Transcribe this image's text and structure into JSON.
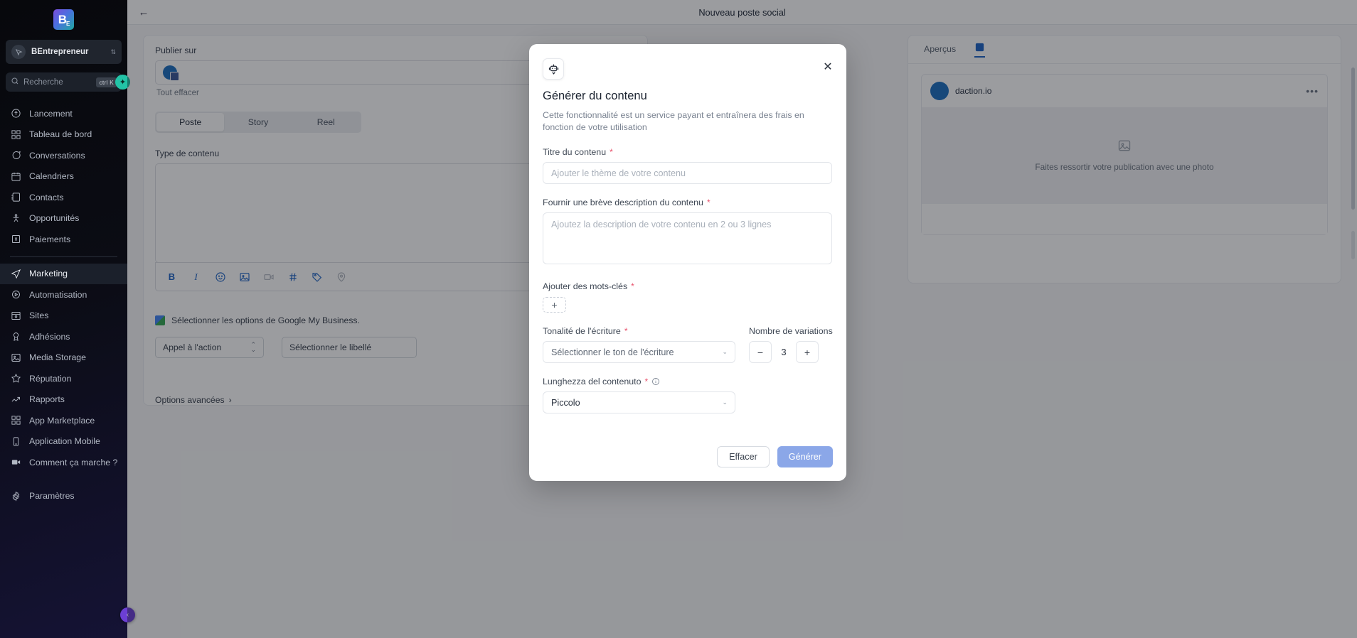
{
  "sidebar": {
    "logo_text": "B",
    "logo_sub": "E",
    "account": {
      "name": "BEntrepreneur",
      "chevron": "⌃⌄"
    },
    "search": {
      "placeholder": "Recherche",
      "shortcut": "ctrl K",
      "spark_icon": "sparkle-icon"
    },
    "items": [
      {
        "label": "Lancement",
        "icon": "rocket-launch-icon",
        "active": false
      },
      {
        "label": "Tableau de bord",
        "icon": "dashboard-grid-icon",
        "active": false
      },
      {
        "label": "Conversations",
        "icon": "chat-bubble-icon",
        "active": false
      },
      {
        "label": "Calendriers",
        "icon": "calendar-icon",
        "active": false
      },
      {
        "label": "Contacts",
        "icon": "contacts-book-icon",
        "active": false
      },
      {
        "label": "Opportunités",
        "icon": "opportunities-icon",
        "active": false
      },
      {
        "label": "Paiements",
        "icon": "payments-icon",
        "active": false
      },
      {
        "label": "Marketing",
        "icon": "send-paper-plane-icon",
        "active": true
      },
      {
        "label": "Automatisation",
        "icon": "play-circle-icon",
        "active": false
      },
      {
        "label": "Sites",
        "icon": "browser-window-icon",
        "active": false
      },
      {
        "label": "Adhésions",
        "icon": "award-badge-icon",
        "active": false
      },
      {
        "label": "Media Storage",
        "icon": "image-icon",
        "active": false
      },
      {
        "label": "Réputation",
        "icon": "star-icon",
        "active": false
      },
      {
        "label": "Rapports",
        "icon": "trend-up-icon",
        "active": false
      },
      {
        "label": "App Marketplace",
        "icon": "apps-grid-icon",
        "active": false
      },
      {
        "label": "Application Mobile",
        "icon": "mobile-phone-icon",
        "active": false
      },
      {
        "label": "Comment ça marche ?",
        "icon": "video-camera-icon",
        "active": false
      }
    ],
    "settings": {
      "label": "Paramètres",
      "icon": "gear-icon"
    },
    "collapse_icon": "chevron-left-icon"
  },
  "topbar": {
    "back_icon": "arrow-left-icon",
    "title": "Nouveau poste social"
  },
  "composer": {
    "publish_label": "Publier sur",
    "account_chip_icon": "facebook-page-icon",
    "clear_all": "Tout effacer",
    "tabs": [
      {
        "label": "Poste",
        "active": true
      },
      {
        "label": "Story",
        "active": false
      },
      {
        "label": "Reel",
        "active": false
      }
    ],
    "content_type_label": "Type de contenu",
    "toolbar_icons": [
      {
        "name": "bold-icon",
        "glyph": "B"
      },
      {
        "name": "italic-icon",
        "glyph": "I"
      },
      {
        "name": "emoji-icon",
        "glyph": "☺"
      },
      {
        "name": "image-icon",
        "glyph": "▣"
      },
      {
        "name": "video-icon",
        "glyph": "▭"
      },
      {
        "name": "hashtag-icon",
        "glyph": "#"
      },
      {
        "name": "tag-icon",
        "glyph": "◇"
      },
      {
        "name": "location-pin-icon",
        "glyph": "◉"
      }
    ],
    "gmb_note": "Sélectionner les options de Google My Business.",
    "gmb_select_1": "Appel à l'action",
    "gmb_select_2": "Sélectionner le libellé",
    "advanced_label": "Options avancées",
    "advanced_chevron": "›"
  },
  "preview": {
    "tabs": [
      {
        "label": "Aperçus",
        "active": false
      },
      {
        "label": "",
        "active": true,
        "icon": "facebook-preview-icon"
      }
    ],
    "account_name": "daction.io",
    "menu_icon": "more-horizontal-icon",
    "placeholder_icon": "image-placeholder-icon",
    "placeholder_text": "Faites ressortir votre publication avec une photo"
  },
  "modal": {
    "badge_icon": "robot-ai-icon",
    "close_icon": "close-icon",
    "title": "Générer du contenu",
    "subtitle": "Cette fonctionnalité est un service payant et entraînera des frais en fonction de votre utilisation",
    "fields": {
      "title": {
        "label": "Titre du contenu",
        "required": "*",
        "placeholder": "Ajouter le thème de votre contenu",
        "value": ""
      },
      "description": {
        "label": "Fournir une brève description du contenu",
        "required": "*",
        "placeholder": "Ajoutez la description de votre contenu en 2 ou 3 lignes",
        "value": ""
      },
      "keywords": {
        "label": "Ajouter des mots-clés",
        "required": "*",
        "add_glyph": "+"
      },
      "tone": {
        "label": "Tonalité de l'écriture",
        "required": "*",
        "value": "Sélectionner le ton de l'écriture",
        "chevron": "⌄"
      },
      "variations": {
        "label": "Nombre de variations",
        "value": "3",
        "minus": "−",
        "plus": "+"
      },
      "length": {
        "label": "Lunghezza del contenuto",
        "required": "*",
        "info_icon": "info-circle-icon",
        "value": "Piccolo",
        "chevron": "⌄"
      }
    },
    "actions": {
      "clear": "Effacer",
      "generate": "Générer"
    },
    "colors": {
      "required_red": "#e8536d",
      "primary_blue": "#8ba7e8"
    }
  }
}
